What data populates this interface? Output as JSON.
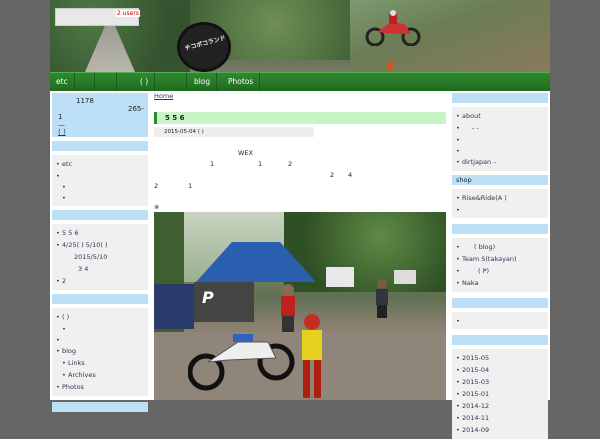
{
  "header": {
    "users_badge": "2 users",
    "tire_text": "チコボコランド"
  },
  "nav": {
    "items": [
      "etc",
      "",
      "",
      "( )",
      "",
      "blog",
      "Photos"
    ]
  },
  "left_sidebar": {
    "profile": {
      "line1": "1178",
      "line2": "265-",
      "line3": "1",
      "line4": "—",
      "line5": "( )"
    },
    "section1": {
      "items": [
        {
          "label": "etc",
          "level": 0
        },
        {
          "label": "",
          "level": 0
        },
        {
          "label": "",
          "level": 1
        },
        {
          "label": "",
          "level": 1
        }
      ]
    },
    "section2": {
      "items": [
        {
          "label": "5 5 6",
          "level": 0
        },
        {
          "label": "4/25( ) 5/10( )",
          "level": 0
        },
        {
          "label": "2015/5/10",
          "level": 2
        },
        {
          "label": "3 4",
          "level": 2
        },
        {
          "label": "2",
          "level": 0
        }
      ]
    },
    "section3": {
      "items": [
        {
          "label": "( )",
          "level": 0
        },
        {
          "label": "",
          "level": 1
        },
        {
          "label": "",
          "level": 0
        },
        {
          "label": "blog",
          "level": 0
        },
        {
          "label": "Links",
          "level": 1
        },
        {
          "label": "Archives",
          "level": 1
        },
        {
          "label": "Photos",
          "level": 0
        }
      ]
    }
  },
  "main": {
    "breadcrumb": "Home",
    "post_title": "5 5 6",
    "post_meta": "2015-05-04 ( )",
    "body": {
      "l1": "WEX",
      "l2a": "1",
      "l2b": "1",
      "l2c": "2",
      "l3a": "2",
      "l3b": "4",
      "l4a": "2",
      "l4b": "1",
      "l5": "※"
    },
    "photo": {
      "banner": "P"
    }
  },
  "right_sidebar": {
    "section1": {
      "items": [
        "about",
        "- -",
        "",
        "",
        "dirtjapan –"
      ]
    },
    "section2": {
      "head": "shop",
      "items": [
        "Rise&Ride(A )",
        ""
      ]
    },
    "section3": {
      "items": [
        "( blog)",
        "Team S(takayan)",
        "( P)",
        "Naka"
      ]
    },
    "section4": {
      "items": [
        ""
      ]
    },
    "section5": {
      "items": [
        "2015-05",
        "2015-04",
        "2015-03",
        "2015-01",
        "2014-12",
        "2014-11",
        "2014-09"
      ]
    }
  }
}
